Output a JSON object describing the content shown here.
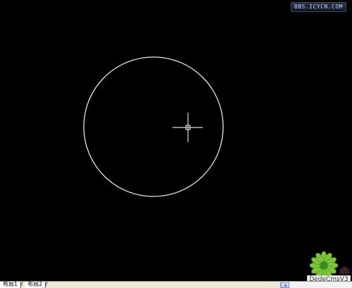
{
  "watermark": {
    "site_text": "BBS.ICYCN.COM"
  },
  "layout_tabs": [
    {
      "label": "布局1"
    },
    {
      "label": "布局2"
    }
  ],
  "logo": {
    "text": "DedeCmsV3",
    "icon": "daisy-flower-icon",
    "flower_color": "#7cc43a",
    "center_color": "#3b8f1e"
  },
  "canvas": {
    "background": "#000000",
    "circle_stroke": "#e8e8e8",
    "crosshair_color": "#d8d8d8"
  },
  "scrollbar": {
    "left_arrow_icon": "chevron-left-icon",
    "left_arrow_glyph": "◂"
  }
}
